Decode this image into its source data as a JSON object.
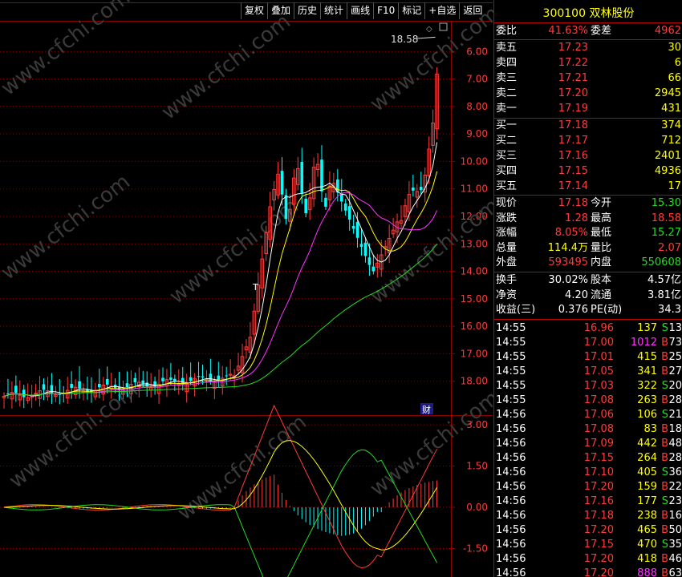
{
  "toolbar": [
    "复权",
    "叠加",
    "历史",
    "统计",
    "画线",
    "F10",
    "标记",
    "+自选",
    "返回"
  ],
  "chart": {
    "price_axis": [
      "18.00",
      "17.00",
      "16.00",
      "15.00",
      "14.00",
      "13.00",
      "12.00",
      "11.00",
      "10.00",
      "9.00",
      "8.00",
      "7.00",
      "6.00"
    ],
    "high_label": "18.58",
    "watermark": "www.cfchi.com",
    "finance_badge": "财",
    "t_marker": "T",
    "macd_axis": [
      "3.00",
      "1.50",
      "0.00",
      "-1.50"
    ],
    "colors": {
      "up": "#ff3b3b",
      "down": "#00ffff",
      "ma5": "#ffffff",
      "ma10": "#ffff00",
      "ma20": "#ff33ff",
      "ma60": "#22dd22",
      "grid": "#8b0000"
    }
  },
  "chart_data": {
    "type": "candlestick",
    "price_ylim": [
      5.0,
      19.0
    ],
    "price_ticks": [
      6,
      7,
      8,
      9,
      10,
      11,
      12,
      13,
      14,
      15,
      16,
      17,
      18
    ],
    "high_annotation": 18.58,
    "macd_ylim": [
      -2.3,
      3.0
    ],
    "macd_ticks": [
      3.0,
      1.5,
      0.0,
      -1.5
    ]
  },
  "stock": {
    "title": "300100 双林股份"
  },
  "weibi": {
    "label1": "委比",
    "value1": "41.63%",
    "label2": "委差",
    "value2": "4962"
  },
  "asks": [
    {
      "label": "卖五",
      "price": "17.23",
      "vol": "30"
    },
    {
      "label": "卖四",
      "price": "17.22",
      "vol": "6"
    },
    {
      "label": "卖三",
      "price": "17.21",
      "vol": "66"
    },
    {
      "label": "卖二",
      "price": "17.20",
      "vol": "2945"
    },
    {
      "label": "卖一",
      "price": "17.19",
      "vol": "431"
    }
  ],
  "bids": [
    {
      "label": "买一",
      "price": "17.18",
      "vol": "374"
    },
    {
      "label": "买二",
      "price": "17.17",
      "vol": "712"
    },
    {
      "label": "买三",
      "price": "17.16",
      "vol": "2401"
    },
    {
      "label": "买四",
      "price": "17.15",
      "vol": "4936"
    },
    {
      "label": "买五",
      "price": "17.14",
      "vol": "17"
    }
  ],
  "quote": [
    {
      "l1": "现价",
      "v1": "17.18",
      "c1": "red",
      "l2": "今开",
      "v2": "15.30",
      "c2": "green"
    },
    {
      "l1": "涨跌",
      "v1": "1.28",
      "c1": "red",
      "l2": "最高",
      "v2": "18.58",
      "c2": "red"
    },
    {
      "l1": "涨幅",
      "v1": "8.05%",
      "c1": "red",
      "l2": "最低",
      "v2": "15.27",
      "c2": "green"
    },
    {
      "l1": "总量",
      "v1": "114.4万",
      "c1": "yellow",
      "l2": "量比",
      "v2": "2.07",
      "c2": "red"
    },
    {
      "l1": "外盘",
      "v1": "593495",
      "c1": "red",
      "l2": "内盘",
      "v2": "550608",
      "c2": "green"
    }
  ],
  "fundamentals": [
    {
      "l1": "换手",
      "v1": "30.02%",
      "l2": "股本",
      "v2": "4.57亿"
    },
    {
      "l1": "净资",
      "v1": "4.20",
      "l2": "流通",
      "v2": "3.81亿"
    },
    {
      "l1": "收益(三)",
      "v1": "0.376",
      "l2": "PE(动)",
      "v2": "34.3"
    }
  ],
  "ticks": [
    {
      "time": "14:55",
      "price": "16.96",
      "vol": "137",
      "side": "S",
      "count": "13"
    },
    {
      "time": "14:55",
      "price": "17.00",
      "vol": "1012",
      "side": "B",
      "count": "73"
    },
    {
      "time": "14:55",
      "price": "17.01",
      "vol": "415",
      "side": "B",
      "count": "25"
    },
    {
      "time": "14:55",
      "price": "17.05",
      "vol": "341",
      "side": "B",
      "count": "27"
    },
    {
      "time": "14:55",
      "price": "17.03",
      "vol": "322",
      "side": "S",
      "count": "20"
    },
    {
      "time": "14:55",
      "price": "17.08",
      "vol": "263",
      "side": "B",
      "count": "28"
    },
    {
      "time": "14:56",
      "price": "17.06",
      "vol": "106",
      "side": "S",
      "count": "21"
    },
    {
      "time": "14:56",
      "price": "17.08",
      "vol": "83",
      "side": "B",
      "count": "18"
    },
    {
      "time": "14:56",
      "price": "17.09",
      "vol": "442",
      "side": "B",
      "count": "48"
    },
    {
      "time": "14:56",
      "price": "17.15",
      "vol": "264",
      "side": "B",
      "count": "28"
    },
    {
      "time": "14:56",
      "price": "17.10",
      "vol": "405",
      "side": "S",
      "count": "36"
    },
    {
      "time": "14:56",
      "price": "17.20",
      "vol": "159",
      "side": "B",
      "count": "22"
    },
    {
      "time": "14:56",
      "price": "17.16",
      "vol": "177",
      "side": "S",
      "count": "23"
    },
    {
      "time": "14:56",
      "price": "17.18",
      "vol": "238",
      "side": "B",
      "count": "16"
    },
    {
      "time": "14:56",
      "price": "17.20",
      "vol": "465",
      "side": "B",
      "count": "50"
    },
    {
      "time": "14:56",
      "price": "17.15",
      "vol": "470",
      "side": "S",
      "count": "35"
    },
    {
      "time": "14:56",
      "price": "17.20",
      "vol": "418",
      "side": "B",
      "count": "46"
    },
    {
      "time": "14:56",
      "price": "17.20",
      "vol": "888",
      "side": "B",
      "count": "63"
    }
  ]
}
